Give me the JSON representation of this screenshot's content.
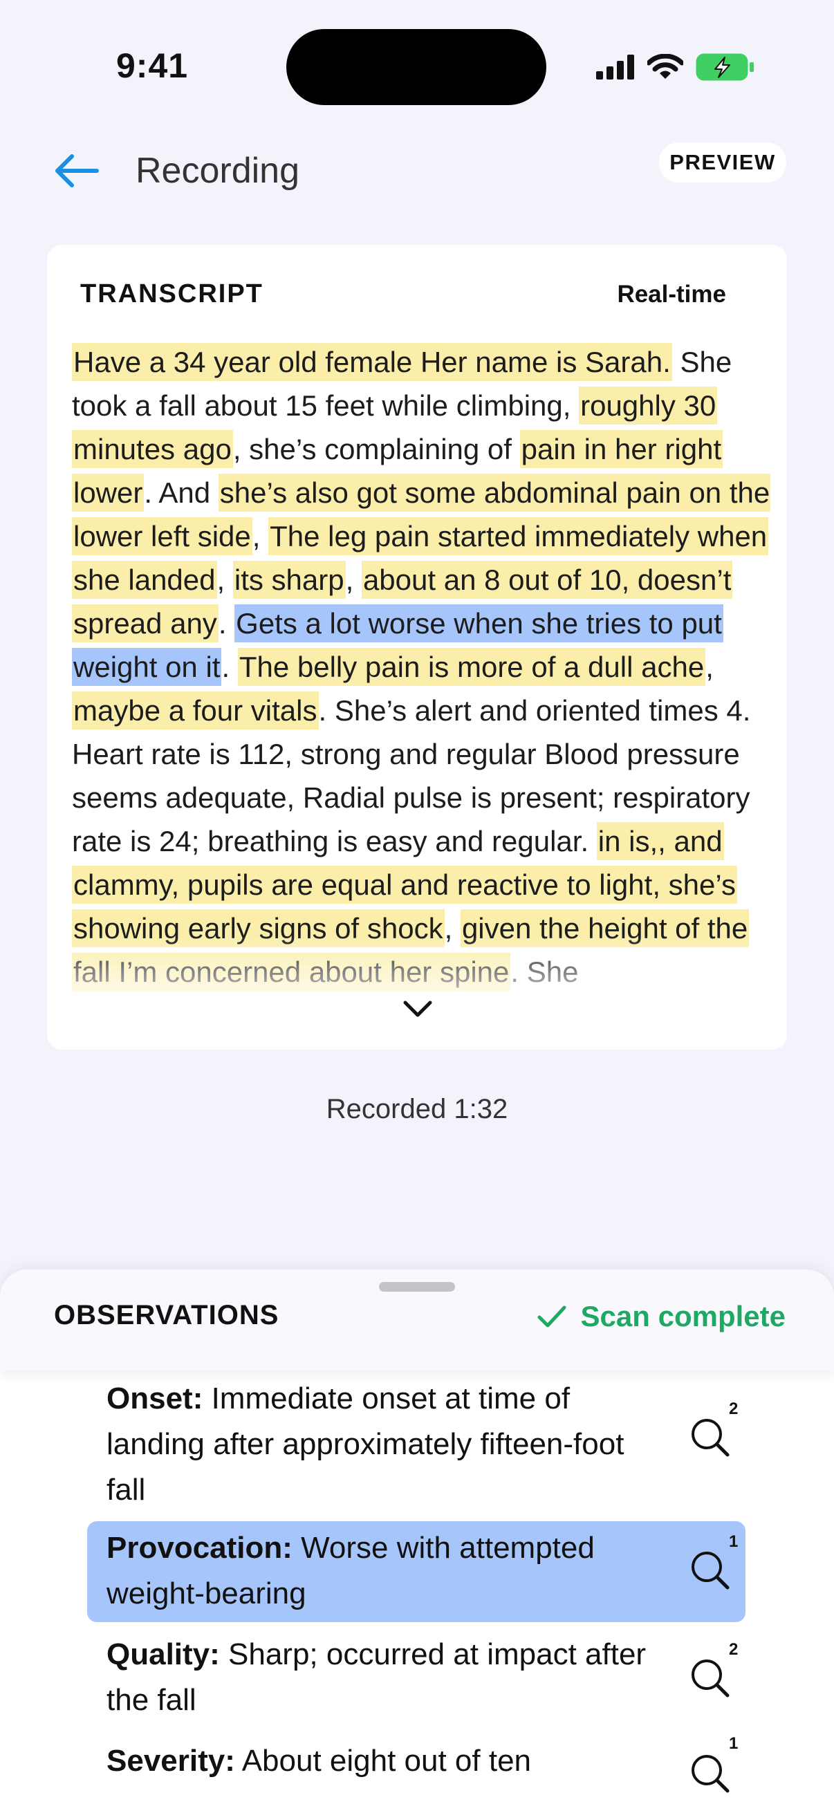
{
  "status_bar": {
    "time": "9:41"
  },
  "header": {
    "title": "Recording",
    "badge": "PREVIEW"
  },
  "transcript": {
    "label": "TRANSCRIPT",
    "mode": "Real-time",
    "segments": [
      {
        "t": "Have a 34 year old female Her name is Sarah.",
        "h": "y"
      },
      {
        "t": " She took a fall about 15 feet while climbing, ",
        "h": ""
      },
      {
        "t": "roughly 30 minutes ago",
        "h": "y"
      },
      {
        "t": ", she’s complaining of ",
        "h": ""
      },
      {
        "t": "pain in her right lower",
        "h": "y"
      },
      {
        "t": ". And ",
        "h": ""
      },
      {
        "t": "she’s also got some abdominal pain on the lower left side",
        "h": "y"
      },
      {
        "t": ", ",
        "h": ""
      },
      {
        "t": "The leg pain started immediately when she landed",
        "h": "y"
      },
      {
        "t": ", ",
        "h": ""
      },
      {
        "t": "its sharp",
        "h": "y"
      },
      {
        "t": ", ",
        "h": ""
      },
      {
        "t": "about an 8 out of 10, doesn’t spread any",
        "h": "y"
      },
      {
        "t": ". ",
        "h": ""
      },
      {
        "t": "Gets a lot worse when she tries to put weight on it",
        "h": "b"
      },
      {
        "t": ". ",
        "h": ""
      },
      {
        "t": "The belly pain is more of a dull ache",
        "h": "y"
      },
      {
        "t": ", ",
        "h": ""
      },
      {
        "t": "maybe a four vitals",
        "h": "y"
      },
      {
        "t": ". She’s alert and oriented times 4. Heart rate is 112, strong and regular Blood pressure seems adequate, Radial pulse is present; respiratory rate is 24; breathing is easy and regular. ",
        "h": ""
      },
      {
        "t": "in is,, and clammy, pupils are equal and reactive to light, she’s showing early signs of shock",
        "h": "y"
      },
      {
        "t": ", ",
        "h": ""
      },
      {
        "t": "given the height of the fall I’m concerned about her spine",
        "h": "y"
      },
      {
        "t": ". She",
        "h": ""
      }
    ],
    "recorded": "Recorded 1:32"
  },
  "observations": {
    "title": "OBSERVATIONS",
    "status": "Scan complete",
    "items": [
      {
        "label": "Onset:",
        "text": " Immediate onset at time of landing after approximately fifteen-foot fall",
        "count": "2",
        "active": false
      },
      {
        "label": "Provocation:",
        "text": " Worse with attempted weight-bearing",
        "count": "1",
        "active": true
      },
      {
        "label": "Quality:",
        "text": " Sharp; occurred at impact after the fall",
        "count": "2",
        "active": false
      },
      {
        "label": "Severity:",
        "text": " About eight out of ten",
        "count": "1",
        "active": false
      }
    ]
  },
  "colors": {
    "accent": "#1a8fe3",
    "highlight_yellow": "#fbeeaa",
    "highlight_blue": "#a6c6fb",
    "success": "#1fa864"
  },
  "icons": [
    "back-arrow-icon",
    "signal-icon",
    "wifi-icon",
    "battery-charging-icon",
    "chevron-down-icon",
    "checkmark-icon",
    "search-icon"
  ]
}
